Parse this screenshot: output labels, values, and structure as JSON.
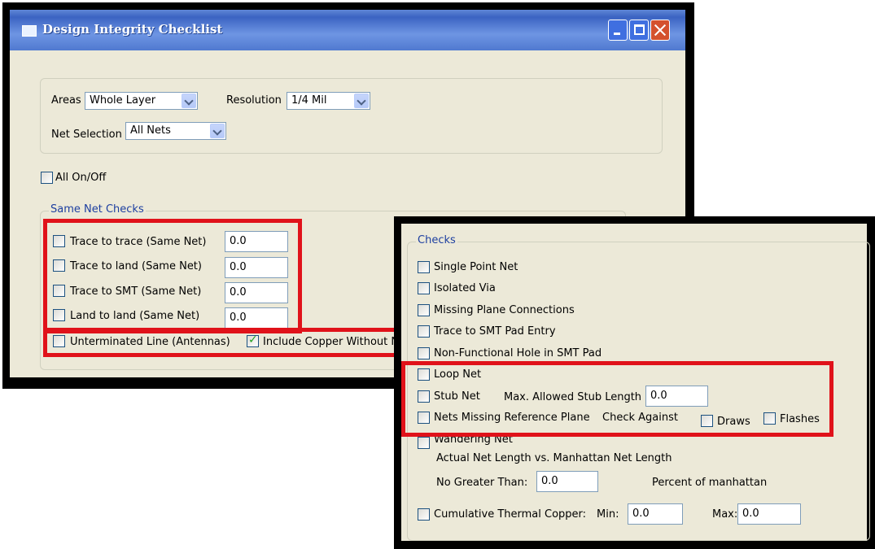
{
  "window": {
    "title": "Design Integrity Checklist"
  },
  "top": {
    "areas_label": "Areas",
    "areas_value": "Whole Layer",
    "resolution_label": "Resolution",
    "resolution_value": "1/4 Mil",
    "net_selection_label": "Net Selection",
    "net_selection_value": "All Nets"
  },
  "all_on_off": "All On/Off",
  "same_net": {
    "legend": "Same Net Checks",
    "rows": [
      {
        "label": "Trace to trace (Same Net)",
        "value": "0.0"
      },
      {
        "label": "Trace to land (Same Net)",
        "value": "0.0"
      },
      {
        "label": "Trace to SMT (Same Net)",
        "value": "0.0"
      },
      {
        "label": "Land to land (Same Net)",
        "value": "0.0"
      }
    ],
    "unterminated": "Unterminated Line (Antennas)",
    "include_copper": "Include Copper Without N"
  },
  "checks": {
    "legend": "Checks",
    "items": [
      "Single Point Net",
      "Isolated Via",
      "Missing Plane Connections",
      "Trace to SMT Pad Entry",
      "Non-Functional Hole in SMT Pad",
      "Loop Net"
    ],
    "stub_net": "Stub Net",
    "max_stub_label": "Max. Allowed Stub Length",
    "max_stub_value": "0.0",
    "nets_missing": "Nets Missing Reference Plane",
    "check_against": "Check Against",
    "draws": "Draws",
    "flashes": "Flashes",
    "wandering": "Wandering Net",
    "actual_vs": "Actual Net Length vs. Manhattan Net Length",
    "no_greater_label": "No Greater Than:",
    "no_greater_value": "0.0",
    "percent_label": "Percent of manhattan",
    "cumulative": "Cumulative Thermal Copper:",
    "min_label": "Min:",
    "min_value": "0.0",
    "max_label": "Max:",
    "max_value": "0.0"
  }
}
